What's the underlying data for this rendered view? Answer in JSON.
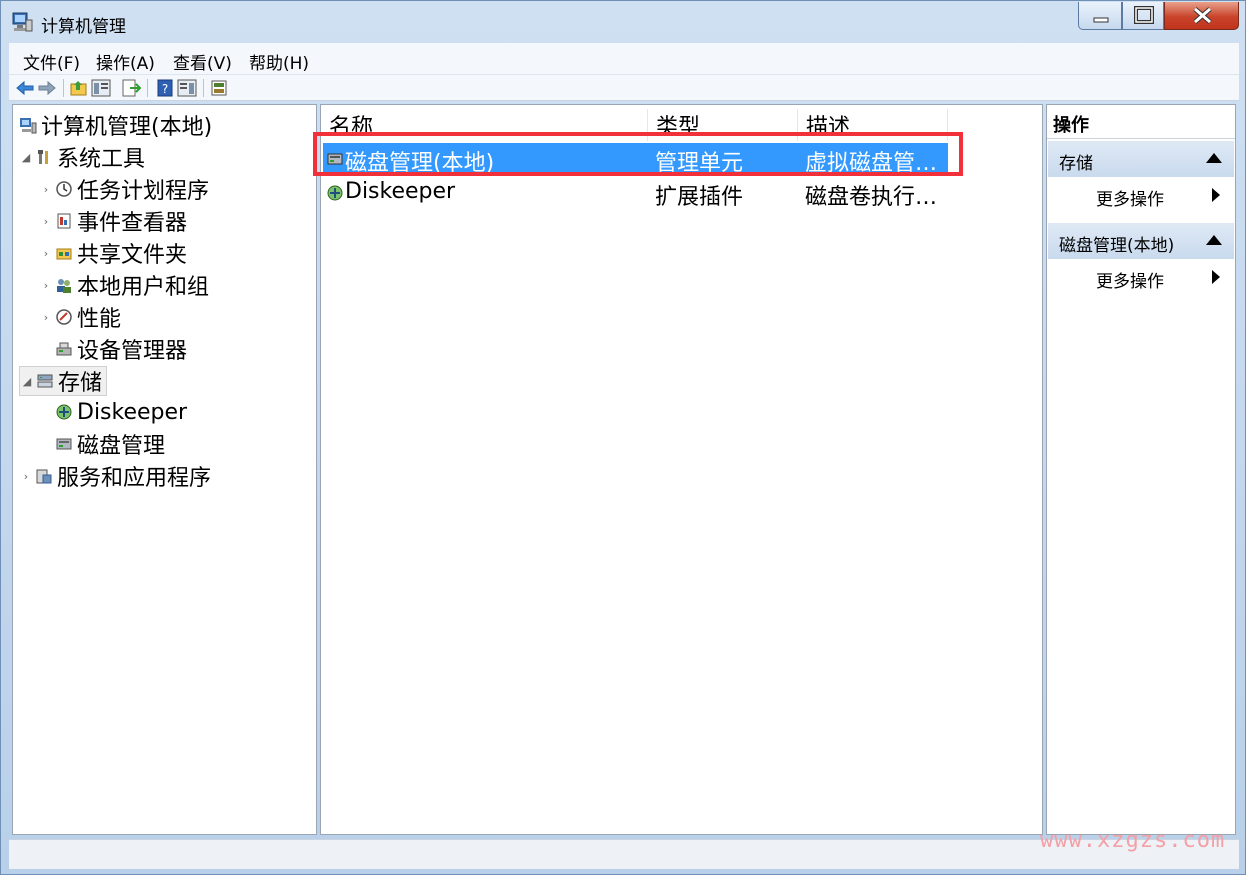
{
  "window": {
    "title": "计算机管理"
  },
  "menu": [
    "文件(F)",
    "操作(A)",
    "查看(V)",
    "帮助(H)"
  ],
  "tree": {
    "root": "计算机管理(本地)",
    "system_tools": "系统工具",
    "task_scheduler": "任务计划程序",
    "event_viewer": "事件查看器",
    "shared_folders": "共享文件夹",
    "local_users": "本地用户和组",
    "performance": "性能",
    "device_manager": "设备管理器",
    "storage": "存储",
    "diskeeper": "Diskeeper",
    "disk_management": "磁盘管理",
    "services_apps": "服务和应用程序"
  },
  "list": {
    "columns": [
      "名称",
      "类型",
      "描述"
    ],
    "rows": [
      {
        "name": "磁盘管理(本地)",
        "type": "管理单元",
        "desc": "虚拟磁盘管…"
      },
      {
        "name": "Diskeeper",
        "type": "扩展插件",
        "desc": "磁盘卷执行…"
      }
    ]
  },
  "actions": {
    "title": "操作",
    "section1": "存储",
    "section2": "磁盘管理(本地)",
    "more": "更多操作"
  },
  "watermark": "www.xzgzs.com"
}
